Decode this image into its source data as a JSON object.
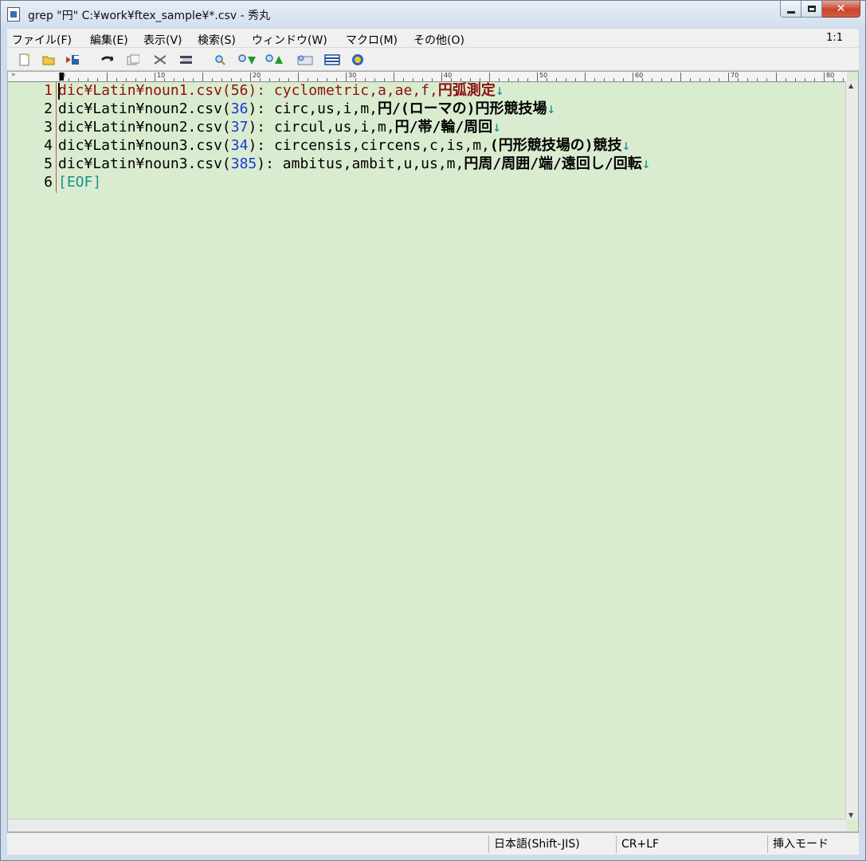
{
  "window": {
    "title": "grep \"円\" C:¥work¥ftex_sample¥*.csv - 秀丸",
    "close_glyph": "✕"
  },
  "menu": {
    "items": [
      "ファイル(F)",
      "編集(E)",
      "表示(V)",
      "検索(S)",
      "ウィンドウ(W)",
      "マクロ(M)",
      "その他(O)"
    ],
    "cursor_position": "1:1"
  },
  "toolbar": {
    "icons": [
      "new-file-icon",
      "open-folder-icon",
      "save-icon",
      "undo-icon",
      "copy-icon",
      "cut-icon",
      "paste-icon",
      "search-icon",
      "find-next-icon",
      "find-prev-icon",
      "grep-icon",
      "window-split-icon",
      "help-icon"
    ]
  },
  "ruler": {
    "labels": [
      "0",
      "10",
      "20",
      "30",
      "40",
      "50",
      "60",
      "70",
      "80"
    ],
    "chevron": "»"
  },
  "lines": [
    {
      "num": "1",
      "parts": [
        {
          "t": "dic¥Latin¥noun1.csv(56): cyclometric,a,ae,f,",
          "c": "red"
        },
        {
          "t": "円弧測定",
          "c": "boldred"
        },
        {
          "t": "↓",
          "c": "teal"
        }
      ]
    },
    {
      "num": "2",
      "parts": [
        {
          "t": "dic¥Latin¥noun2.csv(",
          "c": "plain"
        },
        {
          "t": "36",
          "c": "blue"
        },
        {
          "t": "): circ,us,i,m,",
          "c": "plain"
        },
        {
          "t": "円/(ローマの)円形競技場",
          "c": "bold"
        },
        {
          "t": "↓",
          "c": "teal"
        }
      ]
    },
    {
      "num": "3",
      "parts": [
        {
          "t": "dic¥Latin¥noun2.csv(",
          "c": "plain"
        },
        {
          "t": "37",
          "c": "blue"
        },
        {
          "t": "): circul,us,i,m,",
          "c": "plain"
        },
        {
          "t": "円/帯/輪/周回",
          "c": "bold"
        },
        {
          "t": "↓",
          "c": "teal"
        }
      ]
    },
    {
      "num": "4",
      "parts": [
        {
          "t": "dic¥Latin¥noun3.csv(",
          "c": "plain"
        },
        {
          "t": "34",
          "c": "blue"
        },
        {
          "t": "): circensis,circens,c,is,m,",
          "c": "plain"
        },
        {
          "t": "(円形競技場の)競技",
          "c": "bold"
        },
        {
          "t": "↓",
          "c": "teal"
        }
      ]
    },
    {
      "num": "5",
      "parts": [
        {
          "t": "dic¥Latin¥noun3.csv(",
          "c": "plain"
        },
        {
          "t": "385",
          "c": "blue"
        },
        {
          "t": "): ambitus,ambit,u,us,m,",
          "c": "plain"
        },
        {
          "t": "円周/周囲/端/遠回し/回転",
          "c": "bold"
        },
        {
          "t": "↓",
          "c": "teal"
        }
      ]
    },
    {
      "num": "6",
      "parts": [
        {
          "t": "[EOF]",
          "c": "teal"
        }
      ]
    }
  ],
  "status": {
    "encoding": "日本語(Shift-JIS)",
    "line_ending": "CR+LF",
    "mode": "挿入モード"
  },
  "colors": {
    "editor_bg": "#daecd0",
    "grep_hit": "#8e1010",
    "line_number_ref": "#1a37d6",
    "eof_marker": "#1b8f8f"
  }
}
